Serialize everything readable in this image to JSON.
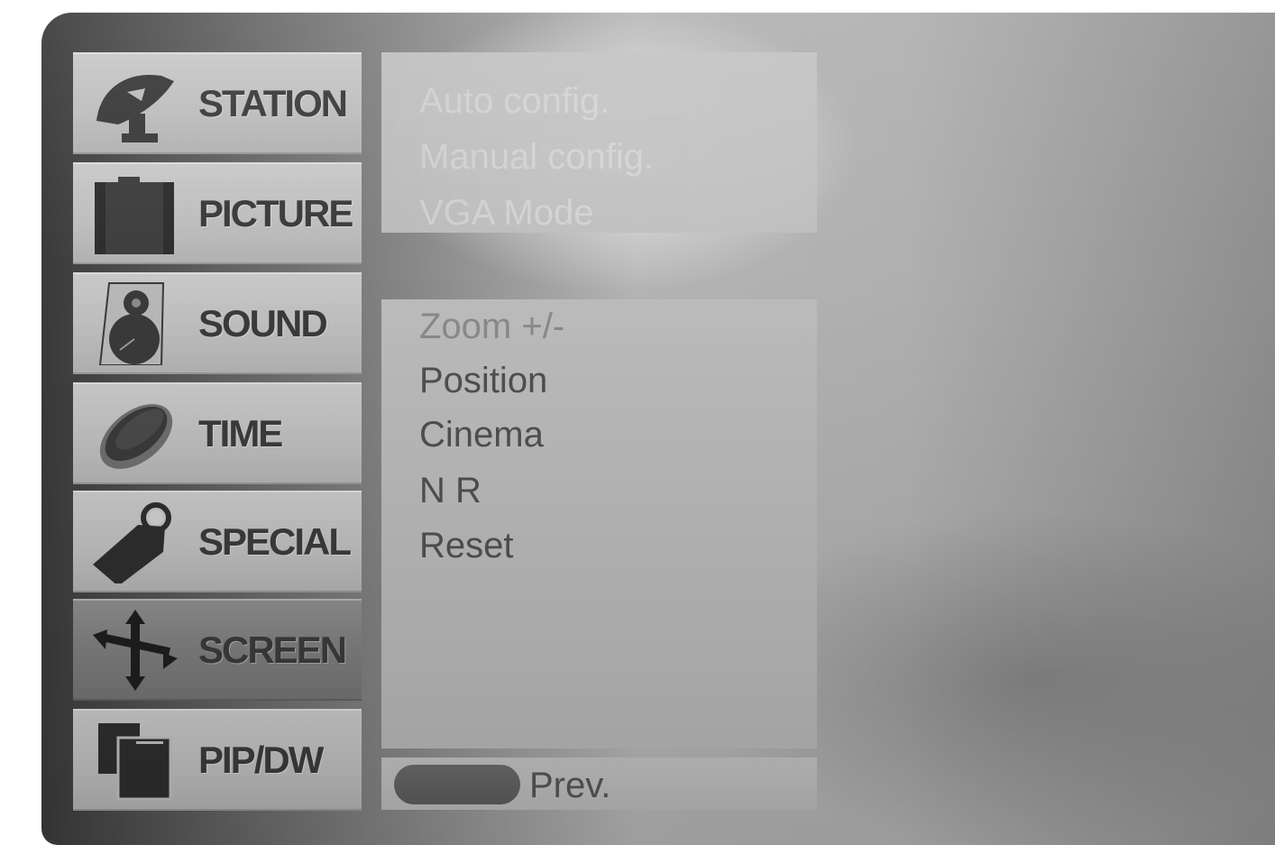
{
  "menu": {
    "items": [
      {
        "label": "STATION",
        "icon": "satellite-dish-icon"
      },
      {
        "label": "PICTURE",
        "icon": "picture-icon"
      },
      {
        "label": "SOUND",
        "icon": "speaker-icon"
      },
      {
        "label": "TIME",
        "icon": "clock-icon"
      },
      {
        "label": "SPECIAL",
        "icon": "tag-key-icon"
      },
      {
        "label": "SCREEN",
        "icon": "move-arrows-icon",
        "active": true
      },
      {
        "label": "PIP/DW",
        "icon": "pip-window-icon"
      }
    ]
  },
  "submenu_top": {
    "items": [
      "Auto config.",
      "Manual config.",
      "VGA Mode"
    ]
  },
  "submenu": {
    "items": [
      "Zoom +/-",
      "Position",
      "Cinema",
      "N R",
      "Reset"
    ]
  },
  "footer": {
    "prev_label": "Prev."
  }
}
